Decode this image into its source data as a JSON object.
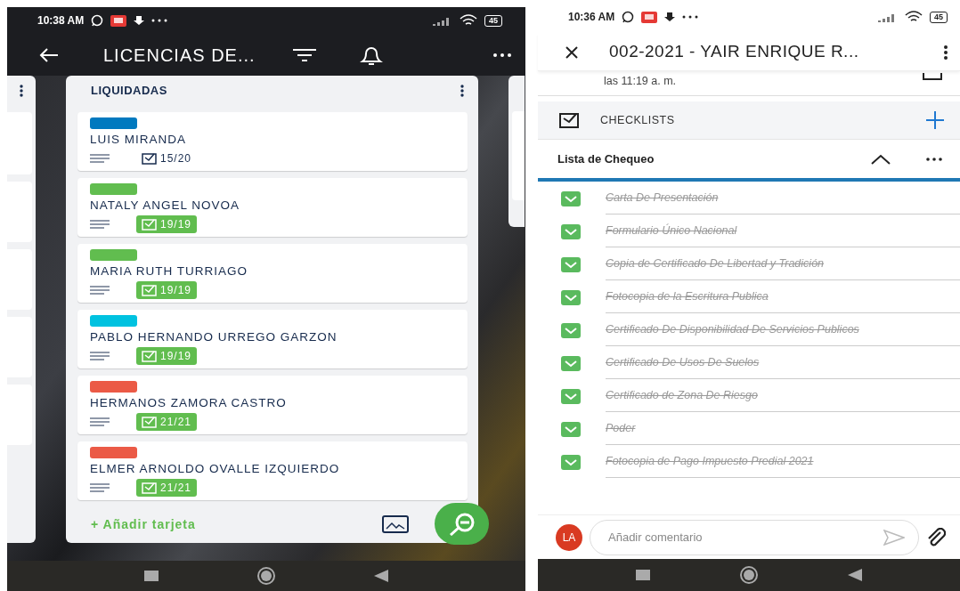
{
  "board_phone": {
    "status_bar": {
      "time": "10:38 AM",
      "battery": "45"
    },
    "header": {
      "title": "LICENCIAS DE..."
    },
    "list": {
      "title": "LIQUIDADAS",
      "add_card": "+ Añadir tarjeta",
      "cards": [
        {
          "color": "#0079bf",
          "name": "LUIS MIRANDA",
          "checklist": "15/20",
          "complete": false
        },
        {
          "color": "#61bd4f",
          "name": "NATALY ANGEL NOVOA",
          "checklist": "19/19",
          "complete": true
        },
        {
          "color": "#61bd4f",
          "name": "MARIA RUTH TURRIAGO",
          "checklist": "19/19",
          "complete": true
        },
        {
          "color": "#00c2e0",
          "name": "PABLO HERNANDO URREGO GARZON",
          "checklist": "19/19",
          "complete": true
        },
        {
          "color": "#eb5a46",
          "name": "HERMANOS ZAMORA CASTRO",
          "checklist": "21/21",
          "complete": true
        },
        {
          "color": "#eb5a46",
          "name": "ELMER ARNOLDO OVALLE IZQUIERDO",
          "checklist": "21/21",
          "complete": true
        }
      ]
    }
  },
  "card_phone": {
    "status_bar": {
      "time": "10:36 AM",
      "battery": "45"
    },
    "header": {
      "title": "002-2021 - YAIR ENRIQUE R..."
    },
    "activity_time": "las 11:19 a. m.",
    "section": {
      "title": "CHECKLISTS"
    },
    "checklist": {
      "title": "Lista de Chequeo",
      "expanded": true,
      "items": [
        {
          "text": "Carta De Presentación",
          "checked": true
        },
        {
          "text": "Formulario Único Nacional",
          "checked": true
        },
        {
          "text": "Copia de Certificado De Libertad y Tradición",
          "checked": true
        },
        {
          "text": "Fotocopia de la Escritura Publica",
          "checked": true
        },
        {
          "text": "Certificado De Disponibilidad De Servicios Publicos",
          "checked": true
        },
        {
          "text": "Certificado De Usos De Suelos",
          "checked": true
        },
        {
          "text": "Certificado de Zona De Riesgo",
          "checked": true
        },
        {
          "text": "Poder",
          "checked": true
        },
        {
          "text": "Fotocopia de Pago Impuesto Predial 2021",
          "checked": true
        }
      ]
    },
    "comment": {
      "avatar": "LA",
      "placeholder": "Añadir comentario"
    }
  }
}
